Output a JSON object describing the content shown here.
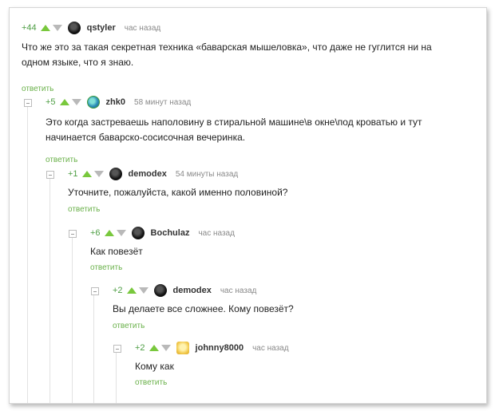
{
  "comments": [
    {
      "rating": "+44",
      "author": "qstyler",
      "time": "час назад",
      "text_lines": [
        "Что же это за такая секретная техника «баварская мышеловка», что даже не гуглится ни на",
        "одном языке, что я знаю."
      ],
      "reply": "ответить",
      "avatar": "dark-avatar-icon"
    },
    {
      "rating": "+5",
      "author": "zhk0",
      "time": "58 минут назад",
      "text_lines": [
        "Это когда застреваешь наполовину в стиральной машине\\в окне\\под кроватью и тут",
        "начинается баварско-сосисочная вечеринка."
      ],
      "reply": "ответить",
      "avatar": "globe-avatar-icon"
    },
    {
      "rating": "+1",
      "author": "demodex",
      "time": "54 минуты назад",
      "text_lines": [
        "Уточните, пожалуйста, какой именно половиной?"
      ],
      "reply": "ответить",
      "avatar": "dark-avatar-icon"
    },
    {
      "rating": "+6",
      "author": "Bochulaz",
      "time": "час назад",
      "text_lines": [
        "Как повезёт"
      ],
      "reply": "ответить",
      "avatar": "dark-avatar-icon"
    },
    {
      "rating": "+2",
      "author": "demodex",
      "time": "час назад",
      "text_lines": [
        "Вы делаете все сложнее. Кому повезёт?"
      ],
      "reply": "ответить",
      "avatar": "dark-avatar-icon"
    },
    {
      "rating": "+2",
      "author": "johnny8000",
      "time": "час назад",
      "text_lines": [
        "Кому как"
      ],
      "reply": "ответить",
      "avatar": "gold-avatar-icon"
    }
  ]
}
